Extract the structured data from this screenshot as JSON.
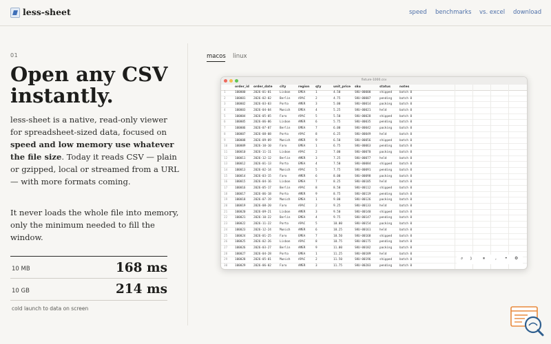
{
  "header": {
    "brand": "less-sheet",
    "nav": [
      "speed",
      "benchmarks",
      "vs. excel",
      "download"
    ]
  },
  "hero": {
    "section_number": "01",
    "title_line1": "Open any CSV",
    "title_line2": "instantly.",
    "para1_a": "less-sheet is a native, read-only viewer for spreadsheet-sized data, focused on ",
    "para1_bold": "speed and low memory use whatever the file size",
    "para1_b": ". Today it reads CSV — plain or gzipped, local or streamed from a URL — with more formats coming.",
    "para2": "It never loads the whole file into memory, only the minimum needed to fill the window.",
    "metrics": [
      {
        "label": "10 MB",
        "value": "168 ms"
      },
      {
        "label": "10 GB",
        "value": "214 ms"
      }
    ],
    "caption": "cold launch to data on screen"
  },
  "demo": {
    "tabs": [
      "macos",
      "linux"
    ],
    "active_tab": "macos",
    "window_title": "fixture-1000.csv",
    "columns": [
      "order_id",
      "order_date",
      "city",
      "region",
      "qty",
      "unit_price",
      "sku",
      "status",
      "notes"
    ],
    "rows": [
      [
        "1",
        "100000",
        "2026-01-01",
        "Lisbon",
        "EMEA",
        "1",
        "4.50",
        "SKU-00000",
        "shipped",
        "batch 0"
      ],
      [
        "2",
        "100001",
        "2026-02-02",
        "Berlin",
        "APAC",
        "2",
        "4.75",
        "SKU-00007",
        "pending",
        "batch 0"
      ],
      [
        "3",
        "100002",
        "2026-03-03",
        "Porto",
        "AMER",
        "3",
        "5.00",
        "SKU-00014",
        "packing",
        "batch 0"
      ],
      [
        "4",
        "100003",
        "2026-04-04",
        "Munich",
        "EMEA",
        "4",
        "5.25",
        "SKU-00021",
        "held",
        "batch 0"
      ],
      [
        "5",
        "100004",
        "2026-05-05",
        "Faro",
        "APAC",
        "5",
        "5.50",
        "SKU-00028",
        "shipped",
        "batch 0"
      ],
      [
        "6",
        "100005",
        "2026-06-06",
        "Lisbon",
        "AMER",
        "6",
        "5.75",
        "SKU-00035",
        "pending",
        "batch 0"
      ],
      [
        "7",
        "100006",
        "2026-07-07",
        "Berlin",
        "EMEA",
        "7",
        "6.00",
        "SKU-00042",
        "packing",
        "batch 0"
      ],
      [
        "8",
        "100007",
        "2026-08-08",
        "Porto",
        "APAC",
        "8",
        "6.25",
        "SKU-00049",
        "held",
        "batch 0"
      ],
      [
        "9",
        "100008",
        "2026-09-09",
        "Munich",
        "AMER",
        "9",
        "6.50",
        "SKU-00056",
        "shipped",
        "batch 0"
      ],
      [
        "10",
        "100009",
        "2026-10-10",
        "Faro",
        "EMEA",
        "1",
        "6.75",
        "SKU-00063",
        "pending",
        "batch 0"
      ],
      [
        "11",
        "100010",
        "2026-11-11",
        "Lisbon",
        "APAC",
        "2",
        "7.00",
        "SKU-00070",
        "packing",
        "batch 0"
      ],
      [
        "12",
        "100011",
        "2026-12-12",
        "Berlin",
        "AMER",
        "3",
        "7.25",
        "SKU-00077",
        "held",
        "batch 0"
      ],
      [
        "13",
        "100012",
        "2026-01-13",
        "Porto",
        "EMEA",
        "4",
        "7.50",
        "SKU-00084",
        "shipped",
        "batch 0"
      ],
      [
        "14",
        "100013",
        "2026-02-14",
        "Munich",
        "APAC",
        "5",
        "7.75",
        "SKU-00091",
        "pending",
        "batch 0"
      ],
      [
        "15",
        "100014",
        "2026-03-15",
        "Faro",
        "AMER",
        "6",
        "8.00",
        "SKU-00098",
        "packing",
        "batch 0"
      ],
      [
        "16",
        "100015",
        "2026-04-16",
        "Lisbon",
        "EMEA",
        "7",
        "8.25",
        "SKU-00105",
        "held",
        "batch 0"
      ],
      [
        "17",
        "100016",
        "2026-05-17",
        "Berlin",
        "APAC",
        "8",
        "8.50",
        "SKU-00112",
        "shipped",
        "batch 0"
      ],
      [
        "18",
        "100017",
        "2026-06-18",
        "Porto",
        "AMER",
        "9",
        "8.75",
        "SKU-00119",
        "pending",
        "batch 0"
      ],
      [
        "19",
        "100018",
        "2026-07-19",
        "Munich",
        "EMEA",
        "1",
        "9.00",
        "SKU-00126",
        "packing",
        "batch 0"
      ],
      [
        "20",
        "100019",
        "2026-08-20",
        "Faro",
        "APAC",
        "2",
        "9.25",
        "SKU-00133",
        "held",
        "batch 0"
      ],
      [
        "21",
        "100020",
        "2026-09-21",
        "Lisbon",
        "AMER",
        "3",
        "9.50",
        "SKU-00140",
        "shipped",
        "batch 0"
      ],
      [
        "22",
        "100021",
        "2026-10-22",
        "Berlin",
        "EMEA",
        "4",
        "9.75",
        "SKU-00147",
        "pending",
        "batch 0"
      ],
      [
        "23",
        "100022",
        "2026-11-22",
        "Porto",
        "APAC",
        "5",
        "10.00",
        "SKU-00154",
        "packing",
        "batch 0"
      ],
      [
        "24",
        "100023",
        "2026-12-24",
        "Munich",
        "AMER",
        "6",
        "10.25",
        "SKU-00161",
        "held",
        "batch 0"
      ],
      [
        "25",
        "100024",
        "2026-01-25",
        "Faro",
        "EMEA",
        "7",
        "10.50",
        "SKU-00168",
        "shipped",
        "batch 0"
      ],
      [
        "26",
        "100025",
        "2026-02-26",
        "Lisbon",
        "APAC",
        "8",
        "10.75",
        "SKU-00175",
        "pending",
        "batch 0"
      ],
      [
        "27",
        "100026",
        "2026-03-27",
        "Berlin",
        "AMER",
        "9",
        "11.00",
        "SKU-00182",
        "packing",
        "batch 0"
      ],
      [
        "28",
        "100027",
        "2026-04-28",
        "Porto",
        "EMEA",
        "1",
        "11.25",
        "SKU-00189",
        "held",
        "batch 0"
      ],
      [
        "29",
        "100028",
        "2026-05-01",
        "Munich",
        "APAC",
        "2",
        "11.50",
        "SKU-00196",
        "shipped",
        "batch 0"
      ],
      [
        "30",
        "100029",
        "2026-06-02",
        "Faro",
        "AMER",
        "3",
        "11.75",
        "SKU-00203",
        "pending",
        "batch 0"
      ],
      [
        "31",
        "100030",
        "2026-07-03",
        "Lisbon",
        "EMEA",
        "4",
        "12.00",
        "SKU-00210",
        "packing",
        "batch 0"
      ],
      [
        "32",
        "100031",
        "2026-08-04",
        "Berlin",
        "APAC",
        "5",
        "12.25",
        "SKU-00217",
        "held",
        "batch 0"
      ],
      [
        "33",
        "100032",
        "2026-09-05",
        "Porto",
        "AMER",
        "6",
        "12.50",
        "SKU-00224",
        "shipped",
        "batch 0"
      ]
    ],
    "toolbar_icons": [
      "search-icon",
      "scroll-sync-icon",
      "skip-icon",
      "comma-separator-icon",
      "more-icon",
      "settings-icon"
    ]
  },
  "colors": {
    "background": "#f7f6f3",
    "nav_link": "#4d6fa8",
    "accent_orange": "#e8893a",
    "accent_blue": "#2f5f8f"
  }
}
